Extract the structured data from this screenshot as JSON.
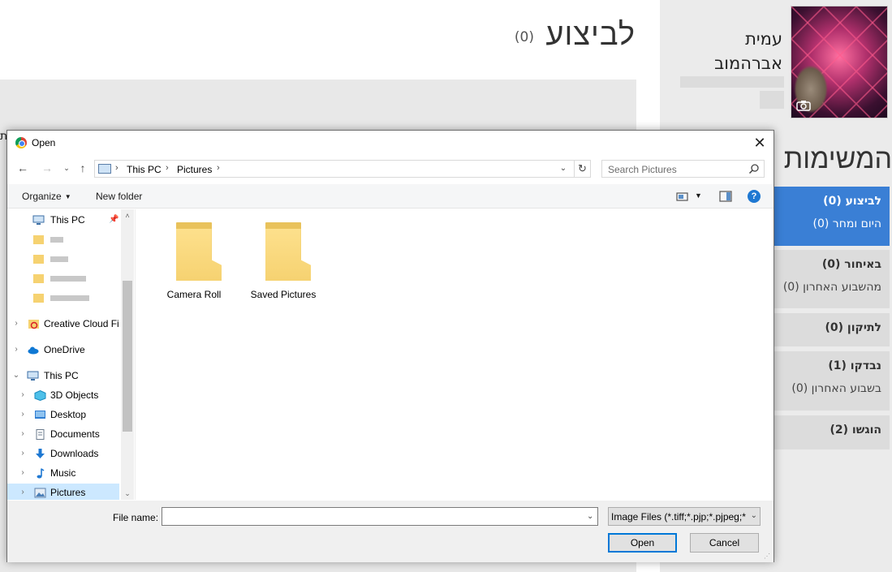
{
  "background_page": {
    "title": "לביצוע",
    "title_count": "(0)",
    "edge_text": "ת",
    "profile": {
      "name_line1": "עמית",
      "name_line2": "אברהמוב"
    },
    "list_title": "המשימות",
    "statuses": [
      {
        "label": "לביצוע (0)",
        "sub": "היום ומחר (0)"
      },
      {
        "label": "באיחור (0)",
        "sub": "מהשבוע האחרון (0)"
      },
      {
        "label": "לתיקון (0)",
        "sub": ""
      },
      {
        "label": "נבדקו (1)",
        "sub": "בשבוע האחרון (0)"
      },
      {
        "label": "הוגשו (2)",
        "sub": ""
      }
    ]
  },
  "dialog": {
    "title": "Open",
    "breadcrumb": [
      "This PC",
      "Pictures"
    ],
    "search_placeholder": "Search Pictures",
    "toolbar": {
      "organize": "Organize",
      "new_folder": "New folder"
    },
    "nav_items": [
      {
        "label": "This PC",
        "icon": "pc-icon",
        "quick_access": true
      },
      {
        "label": "",
        "icon": "folder-icon",
        "blurred": true
      },
      {
        "label": "",
        "icon": "folder-icon",
        "blurred": true
      },
      {
        "label": "",
        "icon": "folder-icon",
        "blurred": true
      },
      {
        "label": "",
        "icon": "folder-icon",
        "blurred": true
      },
      {
        "label": "Creative Cloud Fil",
        "icon": "creative-cloud-icon"
      },
      {
        "label": "OneDrive",
        "icon": "onedrive-icon"
      },
      {
        "label": "This PC",
        "icon": "pc-icon",
        "expanded": true
      },
      {
        "label": "3D Objects",
        "icon": "3d-objects-icon"
      },
      {
        "label": "Desktop",
        "icon": "desktop-icon"
      },
      {
        "label": "Documents",
        "icon": "documents-icon"
      },
      {
        "label": "Downloads",
        "icon": "downloads-icon"
      },
      {
        "label": "Music",
        "icon": "music-icon"
      },
      {
        "label": "Pictures",
        "icon": "pictures-icon",
        "selected": true
      }
    ],
    "folders": [
      {
        "name": "Camera Roll"
      },
      {
        "name": "Saved Pictures"
      }
    ],
    "file_name_label": "File name:",
    "file_name_value": "",
    "filter": "Image Files (*.tiff;*.pjp;*.pjpeg;*",
    "open_button": "Open",
    "cancel_button": "Cancel",
    "colors": {
      "accent": "#0078d7",
      "selected_bg": "#cce8ff",
      "status_active": "#3a7fd5",
      "folder": "#f6d271"
    }
  }
}
